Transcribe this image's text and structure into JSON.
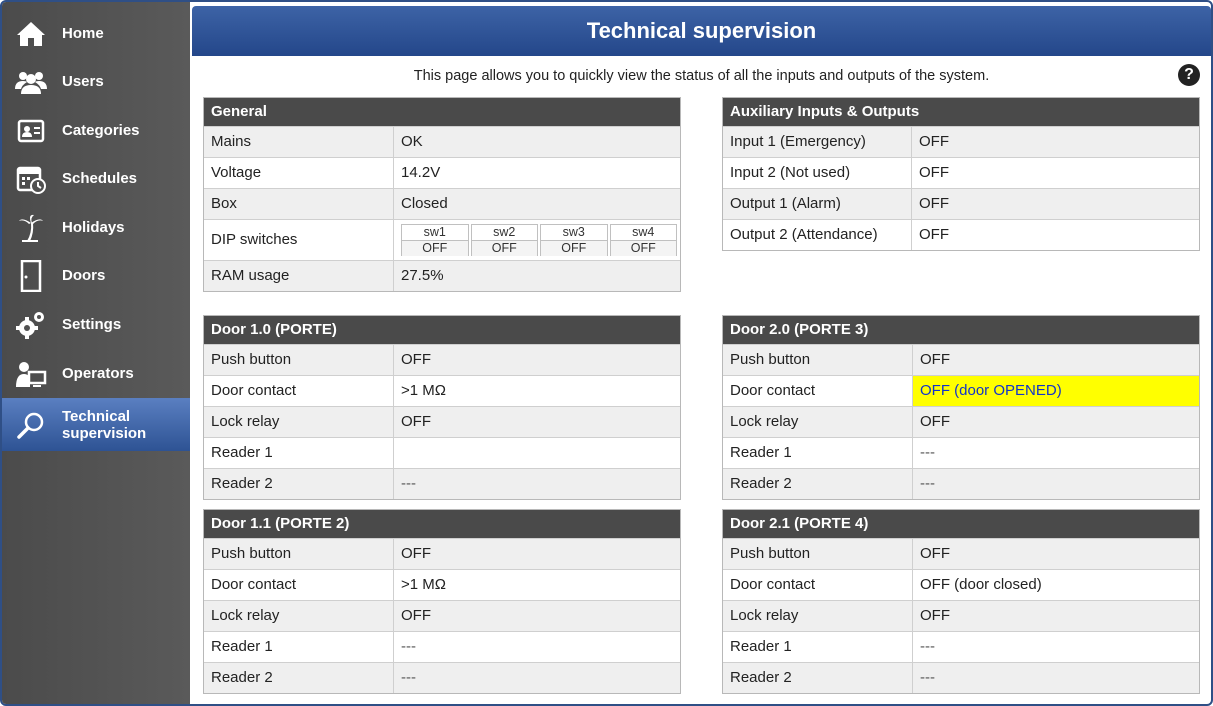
{
  "header": {
    "title": "Technical supervision"
  },
  "intro": "This page allows you to quickly view the status of all the inputs and outputs of the system.",
  "help_icon": "?",
  "sidebar": {
    "items": [
      {
        "label": "Home",
        "icon": "home-icon"
      },
      {
        "label": "Users",
        "icon": "users-icon"
      },
      {
        "label": "Categories",
        "icon": "id-card-icon"
      },
      {
        "label": "Schedules",
        "icon": "calendar-clock-icon"
      },
      {
        "label": "Holidays",
        "icon": "palm-tree-icon"
      },
      {
        "label": "Doors",
        "icon": "door-icon"
      },
      {
        "label": "Settings",
        "icon": "gears-icon"
      },
      {
        "label": "Operators",
        "icon": "operator-icon"
      },
      {
        "label": "Technical",
        "label2": "supervision",
        "icon": "magnifier-icon",
        "active": true
      }
    ]
  },
  "general": {
    "title": "General",
    "rows": [
      {
        "label": "Mains",
        "value": "OK"
      },
      {
        "label": "Voltage",
        "value": "14.2V"
      },
      {
        "label": "Box",
        "value": "Closed"
      },
      {
        "label": "DIP switches",
        "switches": [
          {
            "name": "sw1",
            "state": "OFF"
          },
          {
            "name": "sw2",
            "state": "OFF"
          },
          {
            "name": "sw3",
            "state": "OFF"
          },
          {
            "name": "sw4",
            "state": "OFF"
          }
        ]
      },
      {
        "label": "RAM usage",
        "value": "27.5%"
      }
    ]
  },
  "aux": {
    "title": "Auxiliary Inputs & Outputs",
    "rows": [
      {
        "label": "Input 1 (Emergency)",
        "value": "OFF"
      },
      {
        "label": "Input 2 (Not used)",
        "value": "OFF"
      },
      {
        "label": "Output 1 (Alarm)",
        "value": "OFF"
      },
      {
        "label": "Output 2 (Attendance)",
        "value": "OFF"
      }
    ]
  },
  "door10": {
    "title": "Door 1.0 (PORTE)",
    "rows": [
      {
        "label": "Push button",
        "value": "OFF"
      },
      {
        "label": "Door contact",
        "value": ">1 MΩ"
      },
      {
        "label": "Lock relay",
        "value": "OFF"
      },
      {
        "label": "Reader 1",
        "value": ""
      },
      {
        "label": "Reader 2",
        "value": "---"
      }
    ]
  },
  "door20": {
    "title": "Door 2.0 (PORTE 3)",
    "rows": [
      {
        "label": "Push button",
        "value": "OFF"
      },
      {
        "label": "Door contact",
        "value": "OFF (door OPENED)"
      },
      {
        "label": "Lock relay",
        "value": "OFF"
      },
      {
        "label": "Reader 1",
        "value": "---"
      },
      {
        "label": "Reader 2",
        "value": "---"
      }
    ]
  },
  "door11": {
    "title": "Door 1.1 (PORTE 2)",
    "rows": [
      {
        "label": "Push button",
        "value": "OFF"
      },
      {
        "label": "Door contact",
        "value": ">1 MΩ"
      },
      {
        "label": "Lock relay",
        "value": "OFF"
      },
      {
        "label": "Reader 1",
        "value": "---"
      },
      {
        "label": "Reader 2",
        "value": "---"
      }
    ]
  },
  "door21": {
    "title": "Door 2.1 (PORTE 4)",
    "rows": [
      {
        "label": "Push button",
        "value": "OFF"
      },
      {
        "label": "Door contact",
        "value": "OFF (door closed)"
      },
      {
        "label": "Lock relay",
        "value": "OFF"
      },
      {
        "label": "Reader 1",
        "value": "---"
      },
      {
        "label": "Reader 2",
        "value": "---"
      }
    ]
  },
  "colors": {
    "accent": "#2e5394",
    "sidebar": "#515151",
    "table_header": "#4a4a4a",
    "warning": "#ffff00",
    "warning_text": "#1133cc"
  }
}
